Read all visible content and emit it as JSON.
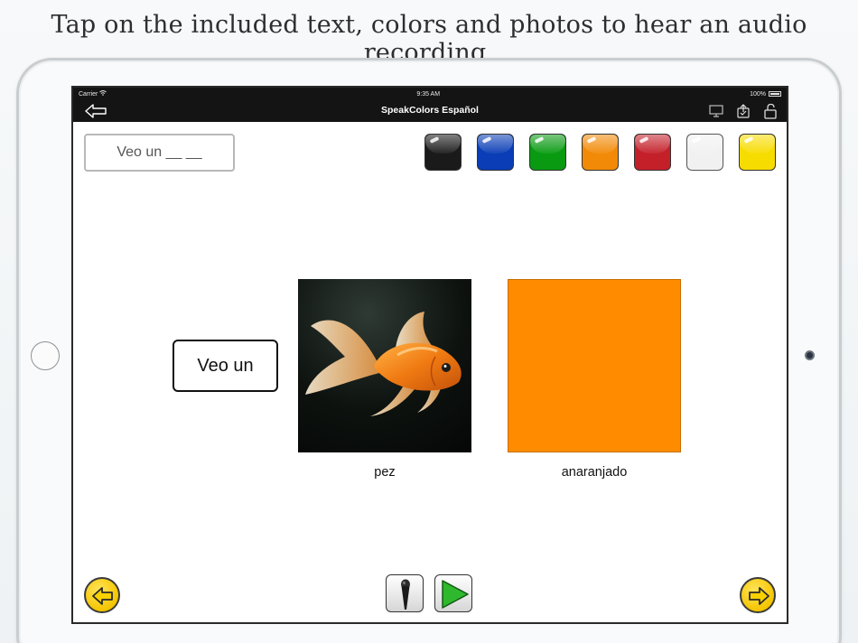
{
  "caption": "Tap on the included text, colors and photos to hear an audio recording.",
  "status_bar": {
    "carrier": "Carrier",
    "time": "9:35 AM",
    "battery": "100%"
  },
  "nav": {
    "title": "SpeakColors Español"
  },
  "sentence_prompt": "Veo un __ __",
  "colors": {
    "swatches": [
      {
        "name": "black",
        "hex": "#1a1a1a"
      },
      {
        "name": "blue",
        "hex": "#0a3db6"
      },
      {
        "name": "green",
        "hex": "#0a9a12"
      },
      {
        "name": "orange",
        "hex": "#f28a08"
      },
      {
        "name": "red",
        "hex": "#c4202a"
      },
      {
        "name": "white",
        "hex": "#f1f1f1"
      },
      {
        "name": "yellow",
        "hex": "#f7dc00"
      }
    ],
    "selected_hex": "#ff8c00"
  },
  "sentence": {
    "word_card": "Veo un",
    "photo_label": "pez",
    "color_label": "anaranjado"
  },
  "icons": {
    "back": "back-arrow-icon",
    "display": "display-icon",
    "share": "share-icon",
    "lock": "unlock-icon",
    "prev": "arrow-left-icon",
    "next": "arrow-right-icon",
    "mic": "microphone-icon",
    "play": "play-icon"
  }
}
